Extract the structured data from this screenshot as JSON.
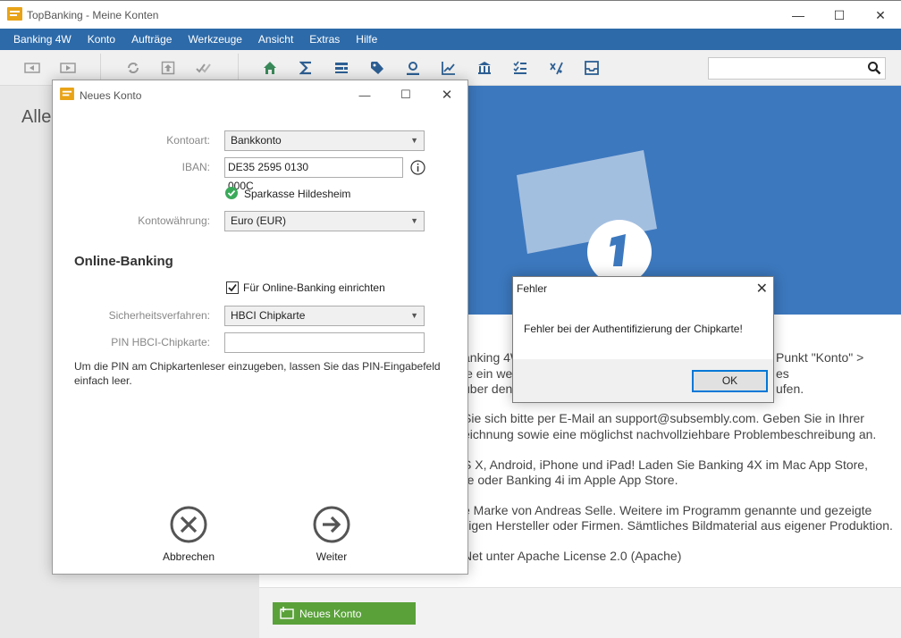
{
  "window": {
    "title": "TopBanking - Meine Konten",
    "minimize": "—",
    "maximize": "☐",
    "close": "✕"
  },
  "menu": [
    "Banking 4W",
    "Konto",
    "Aufträge",
    "Werkzeuge",
    "Ansicht",
    "Extras",
    "Hilfe"
  ],
  "toolbar": {
    "icons": [
      "back-icon",
      "forward-icon",
      "sync-icon",
      "upload-icon",
      "double-check-icon",
      "home-icon",
      "sum-icon",
      "categories-icon",
      "tag-icon",
      "person-icon",
      "chart-icon",
      "bank-icon",
      "checklist-icon",
      "tax-icon",
      "inbox-icon"
    ],
    "search_placeholder": ""
  },
  "background": {
    "heading": "Alle",
    "lines": [
      "anking 4W",
      "Punkt \"Konto\" >",
      "ie ein weit",
      "es",
      "über den",
      "ufen.",
      "Sie sich bitte per E-Mail an support@subsembly.com. Geben Sie in Ihrer",
      "eichnung sowie eine möglichst nachvollziehbare Problembeschreibung an.",
      "S X, Android, iPhone und iPad! Laden Sie Banking 4X im Mac App Store,",
      "re oder Banking 4i im Apple App Store.",
      "e Marke von Andreas Selle. Weitere im Programm genannte und gezeigte",
      "iligen Hersteller oder Firmen. Sämtliches Bildmaterial aus eigener Produktion.",
      "Net unter Apache License 2.0 (Apache)"
    ],
    "badge_number": "1",
    "new_account_button": "Neues Konto"
  },
  "dialog_new": {
    "title": "Neues Konto",
    "kontoart_label": "Kontoart:",
    "kontoart_value": "Bankkonto",
    "iban_label": "IBAN:",
    "iban_value": "DE35 2595 0130 000C",
    "bank_name": "Sparkasse Hildesheim",
    "waehrung_label": "Kontowährung:",
    "waehrung_value": "Euro (EUR)",
    "online_title": "Online-Banking",
    "online_checkbox_label": "Für Online-Banking einrichten",
    "online_checked": true,
    "verfahren_label": "Sicherheitsverfahren:",
    "verfahren_value": "HBCI Chipkarte",
    "pin_label": "PIN HBCI-Chipkarte:",
    "pin_value": "",
    "hint": "Um die PIN am Chipkartenleser einzugeben, lassen Sie das PIN-Eingabefeld einfach leer.",
    "cancel_label": "Abbrechen",
    "next_label": "Weiter"
  },
  "dialog_error": {
    "title": "Fehler",
    "message": "Fehler bei der Authentifizierung der Chipkarte!",
    "ok_label": "OK"
  },
  "colors": {
    "menu_blue": "#2d6aa9",
    "banner_blue": "#3c78be",
    "toolbar_green": "#3a8a5a",
    "button_green": "#5aa13a",
    "ok_border": "#0078d7"
  }
}
